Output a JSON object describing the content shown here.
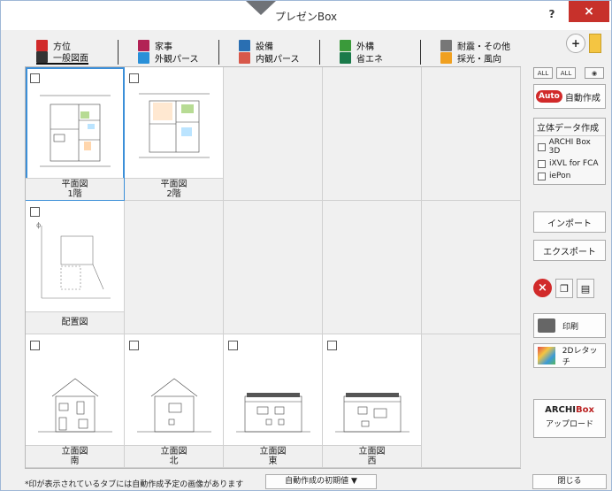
{
  "window": {
    "title": "プレゼンBox",
    "help_label": "?",
    "close_label": "×"
  },
  "tabs": [
    {
      "label": "方位",
      "icon": "compass-icon",
      "color": "#d12a2a",
      "active": false
    },
    {
      "label": "家事",
      "icon": "housework-icon",
      "color": "#b22255",
      "active": false
    },
    {
      "label": "設備",
      "icon": "equipment-icon",
      "color": "#2a6fb2",
      "active": false
    },
    {
      "label": "外構",
      "icon": "exterior-icon",
      "color": "#3a9a3a",
      "active": false
    },
    {
      "label": "耐震・その他",
      "icon": "seismic-icon",
      "color": "#777777",
      "active": false
    },
    {
      "label": "一般図面",
      "icon": "drawing-icon",
      "color": "#333333",
      "active": true
    },
    {
      "label": "外観パース",
      "icon": "exterior-perspective-icon",
      "color": "#2a90d8",
      "active": false
    },
    {
      "label": "内観パース",
      "icon": "interior-perspective-icon",
      "color": "#d8584a",
      "active": false
    },
    {
      "label": "省エネ",
      "icon": "energy-saving-icon",
      "color": "#1a7a4a",
      "active": false
    },
    {
      "label": "採光・風向",
      "icon": "sunlight-icon",
      "color": "#f0a020",
      "active": false
    }
  ],
  "toolbar": {
    "zoom_label": "+"
  },
  "grid": {
    "cells": [
      {
        "line1": "平面図",
        "line2": "1階",
        "thumb": "floorplan-1f",
        "selected": true
      },
      {
        "line1": "平面図",
        "line2": "2階",
        "thumb": "floorplan-2f",
        "selected": false
      },
      null,
      null,
      null,
      {
        "line1": "配置図",
        "line2": "",
        "thumb": "site-plan",
        "selected": false
      },
      null,
      null,
      null,
      null,
      {
        "line1": "立面図",
        "line2": "南",
        "thumb": "elevation-south",
        "selected": false
      },
      {
        "line1": "立面図",
        "line2": "北",
        "thumb": "elevation-north",
        "selected": false
      },
      {
        "line1": "立面図",
        "line2": "東",
        "thumb": "elevation-east",
        "selected": false
      },
      {
        "line1": "立面図",
        "line2": "西",
        "thumb": "elevation-west",
        "selected": false
      },
      null
    ]
  },
  "side": {
    "all_on_label": "ALL",
    "all_off_label": "ALL",
    "auto_badge": "Auto",
    "auto_label": "自動作成",
    "solid_header": "立体データ作成",
    "solid_options": [
      "ARCHI Box 3D",
      "iXVL for FCA",
      "iePon"
    ],
    "import_label": "インポート",
    "export_label": "エクスポート",
    "delete_label": "×",
    "print_label": "印刷",
    "touch_label": "2Dレタッチ",
    "archi_logo_a": "ARCHI",
    "archi_logo_b": "Box",
    "upload_label": "アップロード"
  },
  "bottom": {
    "note": "*印が表示されているタブには自動作成予定の画像があります",
    "defaults_label": "自動作成の初期値 ▼",
    "close_label": "閉じる"
  }
}
